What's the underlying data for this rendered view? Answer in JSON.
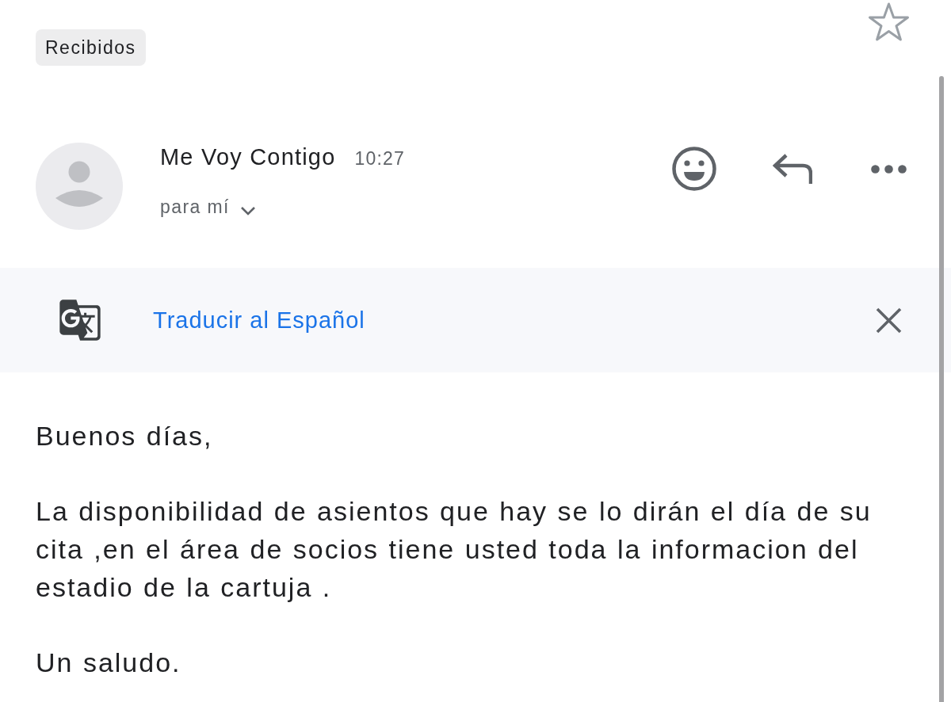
{
  "header": {
    "mailbox_label": "Recibidos",
    "starred": false
  },
  "message": {
    "sender": "Me Voy Contigo",
    "time": "10:27",
    "recipient": "para mí"
  },
  "translate_bar": {
    "label": "Traducir al Español"
  },
  "body": {
    "paragraphs": [
      "Buenos días,",
      "La disponibilidad de asientos que hay se lo dirán el día de su cita ,en el área de socios tiene usted toda la informacion del estadio de la cartuja .",
      "Un saludo."
    ]
  }
}
